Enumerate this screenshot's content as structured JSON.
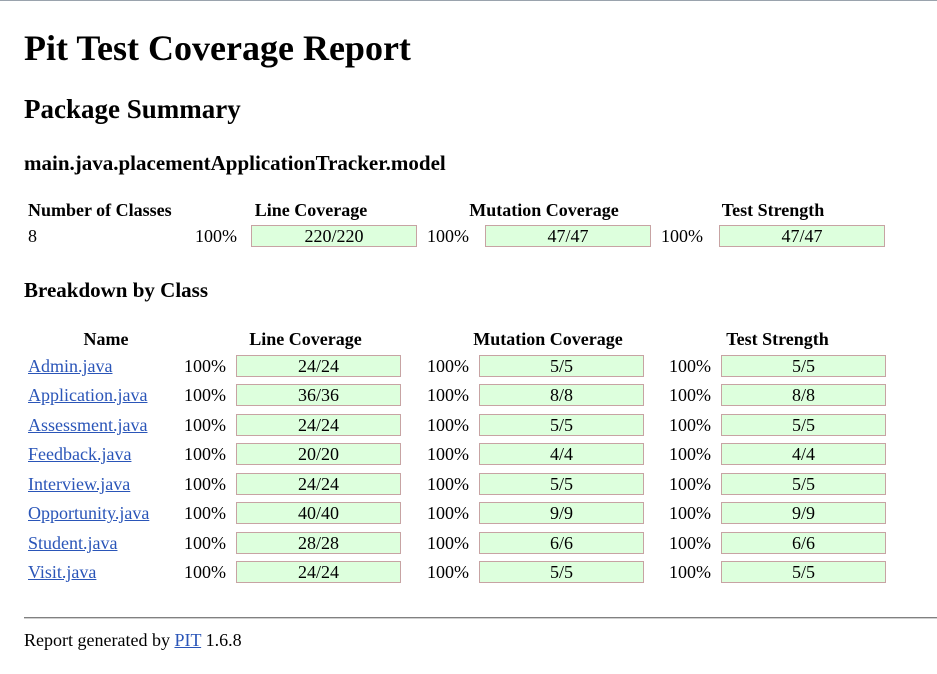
{
  "title": "Pit Test Coverage Report",
  "section_title": "Package Summary",
  "package_name": "main.java.placementApplicationTracker.model",
  "summary": {
    "headers": [
      "Number of Classes",
      "Line Coverage",
      "Mutation Coverage",
      "Test Strength"
    ],
    "classes": "8",
    "line": {
      "pct": "100%",
      "ratio": "220/220"
    },
    "mutation": {
      "pct": "100%",
      "ratio": "47/47"
    },
    "strength": {
      "pct": "100%",
      "ratio": "47/47"
    }
  },
  "breakdown_title": "Breakdown by Class",
  "breakdown": {
    "headers": [
      "Name",
      "Line Coverage",
      "Mutation Coverage",
      "Test Strength"
    ],
    "rows": [
      {
        "name": "Admin.java",
        "line_pct": "100%",
        "line": "24/24",
        "mut_pct": "100%",
        "mut": "5/5",
        "str_pct": "100%",
        "str": "5/5"
      },
      {
        "name": "Application.java",
        "line_pct": "100%",
        "line": "36/36",
        "mut_pct": "100%",
        "mut": "8/8",
        "str_pct": "100%",
        "str": "8/8"
      },
      {
        "name": "Assessment.java",
        "line_pct": "100%",
        "line": "24/24",
        "mut_pct": "100%",
        "mut": "5/5",
        "str_pct": "100%",
        "str": "5/5"
      },
      {
        "name": "Feedback.java",
        "line_pct": "100%",
        "line": "20/20",
        "mut_pct": "100%",
        "mut": "4/4",
        "str_pct": "100%",
        "str": "4/4"
      },
      {
        "name": "Interview.java",
        "line_pct": "100%",
        "line": "24/24",
        "mut_pct": "100%",
        "mut": "5/5",
        "str_pct": "100%",
        "str": "5/5"
      },
      {
        "name": "Opportunity.java",
        "line_pct": "100%",
        "line": "40/40",
        "mut_pct": "100%",
        "mut": "9/9",
        "str_pct": "100%",
        "str": "9/9"
      },
      {
        "name": "Student.java",
        "line_pct": "100%",
        "line": "28/28",
        "mut_pct": "100%",
        "mut": "6/6",
        "str_pct": "100%",
        "str": "6/6"
      },
      {
        "name": "Visit.java",
        "line_pct": "100%",
        "line": "24/24",
        "mut_pct": "100%",
        "mut": "5/5",
        "str_pct": "100%",
        "str": "5/5"
      }
    ]
  },
  "footer": {
    "prefix": "Report generated by",
    "link": "PIT",
    "version": "1.6.8"
  },
  "colors": {
    "bar_fill": "#ddffdd",
    "bar_border": "#c7a3a3",
    "link": "#2a55b8"
  }
}
